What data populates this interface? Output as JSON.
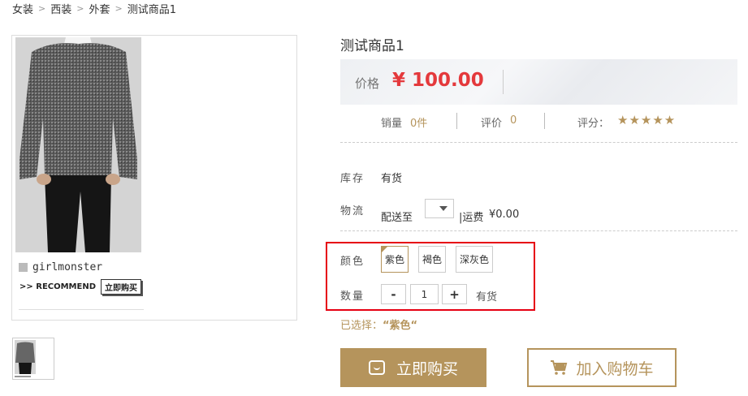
{
  "breadcrumb": [
    "女装",
    "西装",
    "外套",
    "测试商品1"
  ],
  "product": {
    "title": "测试商品1",
    "price_label": "价格",
    "price": "¥ 100.00"
  },
  "main_image": {
    "watermark_text": "girlmonster",
    "recommend_text": ">> RECOMMEND",
    "recommend_button": "立即购买"
  },
  "stats": {
    "sales_label": "销量",
    "sales_value": "0件",
    "reviews_label": "评价",
    "reviews_value": "0",
    "rating_label": "评分：",
    "rating_stars": "★★★★★",
    "rating_value": 5
  },
  "stock": {
    "label": "库存",
    "value": "有货"
  },
  "logistics": {
    "label": "物流",
    "ship_to": "配送至",
    "freight_label": "|运费",
    "freight_value": "¥0.00"
  },
  "color": {
    "label": "颜色",
    "options": [
      "紫色",
      "褐色",
      "深灰色"
    ],
    "selected": "紫色"
  },
  "quantity": {
    "label": "数量",
    "minus": "-",
    "value": "1",
    "plus": "+",
    "stock_status": "有货"
  },
  "selection": {
    "prefix": "已选择：",
    "value": "“紫色“"
  },
  "actions": {
    "buy_now": "立即购买",
    "add_to_cart": "加入购物车"
  },
  "colors": {
    "accent": "#b5945c",
    "price": "#e4393c",
    "highlight_box": "#e60012"
  }
}
